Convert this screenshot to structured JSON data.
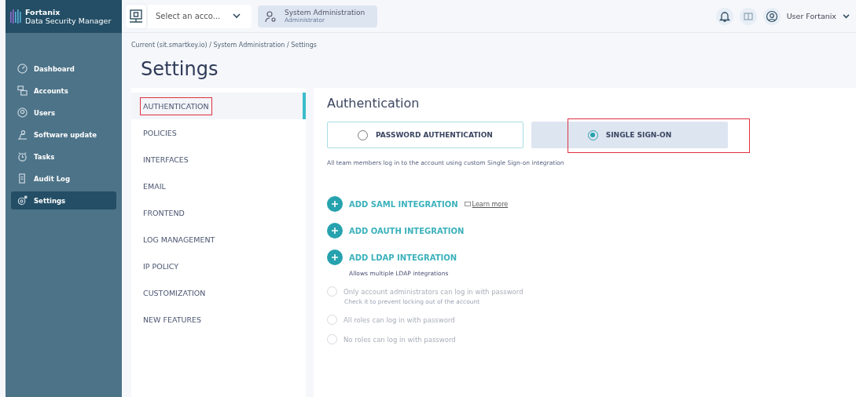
{
  "brand": {
    "name": "Fortanix",
    "product": "Data Security Manager"
  },
  "topbar": {
    "account_select": {
      "placeholder": "Select an acco..."
    },
    "context": {
      "title": "System Administration",
      "role": "Administrator"
    },
    "user": "User Fortanix"
  },
  "sidebar": {
    "items": [
      {
        "label": "Dashboard",
        "selected": false
      },
      {
        "label": "Accounts",
        "selected": false
      },
      {
        "label": "Users",
        "selected": false
      },
      {
        "label": "Software update",
        "selected": false
      },
      {
        "label": "Tasks",
        "selected": false
      },
      {
        "label": "Audit Log",
        "selected": false
      },
      {
        "label": "Settings",
        "selected": true
      }
    ]
  },
  "breadcrumb": "Current (sit.smartkey.io) / System Administration / Settings",
  "page_title": "Settings",
  "settings_nav": [
    {
      "label": "AUTHENTICATION",
      "selected": true,
      "highlighted": true
    },
    {
      "label": "POLICIES",
      "selected": false,
      "highlighted": false
    },
    {
      "label": "INTERFACES",
      "selected": false,
      "highlighted": false
    },
    {
      "label": "EMAIL",
      "selected": false,
      "highlighted": false
    },
    {
      "label": "FRONTEND",
      "selected": false,
      "highlighted": false
    },
    {
      "label": "LOG MANAGEMENT",
      "selected": false,
      "highlighted": false
    },
    {
      "label": "IP POLICY",
      "selected": false,
      "highlighted": false
    },
    {
      "label": "CUSTOMIZATION",
      "selected": false,
      "highlighted": false
    },
    {
      "label": "NEW FEATURES",
      "selected": false,
      "highlighted": false
    }
  ],
  "section_title": "Authentication",
  "auth_modes": [
    {
      "label": "PASSWORD AUTHENTICATION",
      "selected": false,
      "highlighted": false
    },
    {
      "label": "SINGLE SIGN-ON",
      "selected": true,
      "highlighted": true
    }
  ],
  "mode_description": "All team members log in to the account using custom Single Sign-on integration",
  "integrations": [
    {
      "label": "ADD SAML INTEGRATION",
      "link": "Learn more"
    },
    {
      "label": "ADD OAUTH INTEGRATION"
    },
    {
      "label": "ADD LDAP INTEGRATION",
      "note": "Allows multiple LDAP integrations"
    }
  ],
  "password_options": [
    {
      "label": "Only account administrators can log in with password",
      "hint": "Check it to prevent locking out of the account",
      "selected": false,
      "disabled": true
    },
    {
      "label": "All roles can log in with password",
      "selected": false,
      "disabled": true
    },
    {
      "label": "No roles can log in with password",
      "selected": false,
      "disabled": true
    }
  ]
}
